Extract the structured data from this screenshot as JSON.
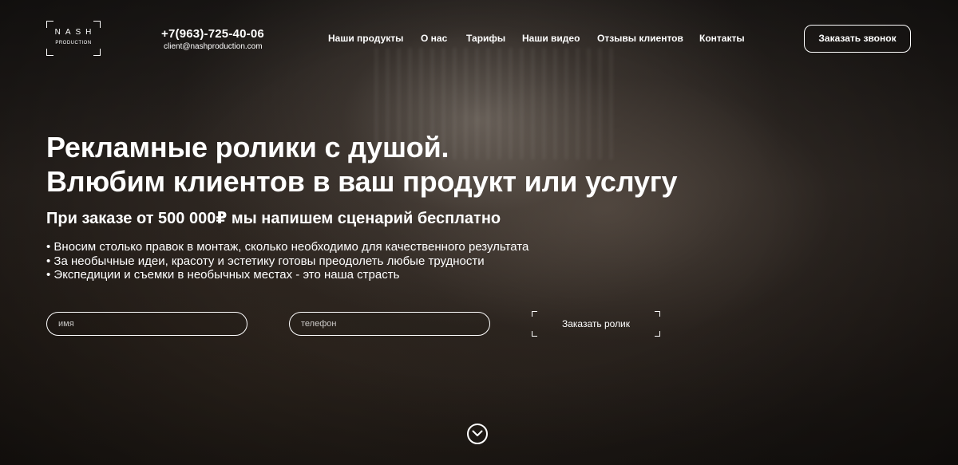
{
  "header": {
    "logo": {
      "line1": "NASH",
      "line2": "PRODUCTION"
    },
    "phone": "+7(963)-725-40-06",
    "email": "client@nashproduction.com",
    "nav": [
      {
        "label": "Наши продукты"
      },
      {
        "label": "О нас"
      },
      {
        "label": "Тарифы"
      },
      {
        "label": "Наши видео"
      },
      {
        "label": "Отзывы клиентов"
      },
      {
        "label": "Контакты"
      }
    ],
    "call_button_label": "Заказать звонок"
  },
  "hero": {
    "title_line1": "Рекламные ролики с душой.",
    "title_line2": "Влюбим клиентов в ваш продукт или услугу",
    "subtitle": "При заказе от 500 000₽ мы напишем сценарий бесплатно",
    "features": [
      "• Вносим столько правок в монтаж, сколько необходимо для качественного результата",
      "• За необычные идеи, красоту и эстетику готовы преодолеть любые трудности",
      "• Экспедиции и съемки в необычных местах - это наша страсть"
    ]
  },
  "form": {
    "name_placeholder": "имя",
    "name_value": "",
    "phone_placeholder": "телефон",
    "phone_value": "",
    "submit_label": "Заказать ролик"
  },
  "icons": {
    "scroll_down": "chevron-down-circle-icon"
  },
  "colors": {
    "text": "#ffffff",
    "background": "#1a1715"
  }
}
